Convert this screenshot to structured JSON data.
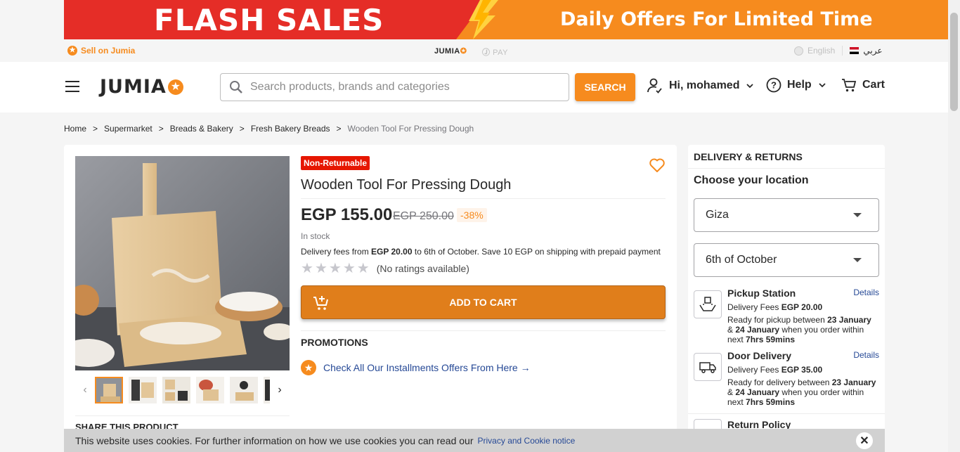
{
  "banner": {
    "flash": "FLASH SALES",
    "daily": "Daily Offers For Limited Time"
  },
  "topstrip": {
    "sell": "Sell on Jumia",
    "jumia_mini": "JUMIA",
    "pay_mini": "PAY",
    "english": "English",
    "arabic": "عربي"
  },
  "header": {
    "logo": "JUMIA",
    "search_placeholder": "Search products, brands and categories",
    "search_button": "SEARCH",
    "account": "Hi, mohamed",
    "help": "Help",
    "cart": "Cart"
  },
  "breadcrumb": [
    "Home",
    "Supermarket",
    "Breads & Bakery",
    "Fresh Bakery Breads",
    "Wooden Tool For Pressing Dough"
  ],
  "product": {
    "badge": "Non-Returnable",
    "title": "Wooden Tool For Pressing Dough",
    "price": "EGP 155.00",
    "old_price": "EGP 250.00",
    "discount": "-38%",
    "stock": "In stock",
    "delivery_prefix": "Delivery fees from ",
    "delivery_fee": "EGP 20.00",
    "delivery_suffix": " to 6th of October. Save 10 EGP on shipping with prepaid payment",
    "ratings": "(No ratings available)",
    "rating_value": 0,
    "rating_max": 5,
    "add_to_cart": "ADD TO CART",
    "promotions": "PROMOTIONS",
    "promo_link": "Check All Our Installments Offers From Here →",
    "share": "SHARE THIS PRODUCT"
  },
  "side": {
    "heading": "DELIVERY & RETURNS",
    "choose": "Choose your location",
    "region": "Giza",
    "city": "6th of October",
    "pickup": {
      "title": "Pickup Station",
      "details": "Details",
      "fee_label": "Delivery Fees ",
      "fee": "EGP 20.00",
      "ready_1": "Ready for pickup between ",
      "date_1": "23 January",
      "ready_2": " & ",
      "date_2": "24 January",
      "ready_3": " when you order within next ",
      "window": "7hrs 59mins"
    },
    "door": {
      "title": "Door Delivery",
      "details": "Details",
      "fee_label": "Delivery Fees ",
      "fee": "EGP 35.00",
      "ready_1": "Ready for delivery between ",
      "date_1": "23 January",
      "ready_2": " & ",
      "date_2": "24 January",
      "ready_3": " when you order within next ",
      "window": "7hrs 59mins"
    },
    "return": "Return Policy"
  },
  "cookie": {
    "text": "This website uses cookies. For further information on how we use cookies you can read our",
    "link": "Privacy and Cookie notice",
    "close": "✕"
  },
  "colors": {
    "accent": "#f68b1e",
    "badge": "#e61601",
    "link": "#264996"
  }
}
